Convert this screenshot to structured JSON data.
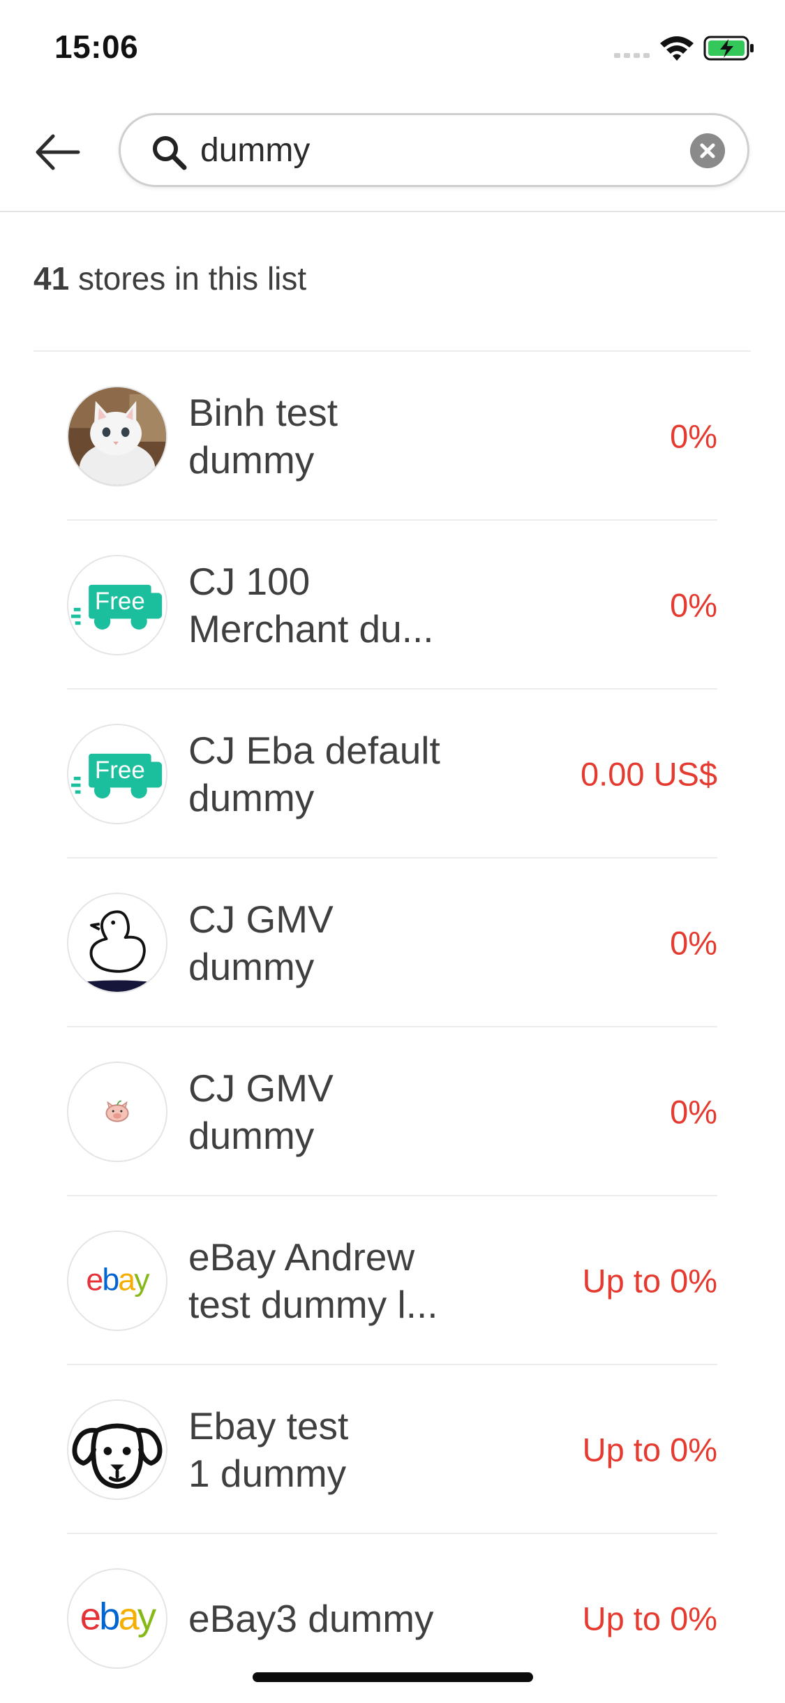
{
  "status_bar": {
    "time": "15:06"
  },
  "search": {
    "value": "dummy"
  },
  "count": {
    "number": "41",
    "label": "stores in this list"
  },
  "stores": [
    {
      "line1": "Binh test",
      "line2": "dummy",
      "rate": "0%",
      "logo": "cat-photo"
    },
    {
      "line1": "CJ 100",
      "line2": "Merchant du...",
      "rate": "0%",
      "logo": "free-shipping-truck",
      "logo_text": "Free"
    },
    {
      "line1": "CJ Eba default",
      "line2": "dummy",
      "rate": "0.00 US$",
      "logo": "free-shipping-truck",
      "logo_text": "Free"
    },
    {
      "line1": "CJ GMV",
      "line2": "dummy",
      "rate": "0%",
      "logo": "duck-outline"
    },
    {
      "line1": "CJ GMV",
      "line2": "dummy",
      "rate": "0%",
      "logo": "pig-face"
    },
    {
      "line1": "eBay Andrew",
      "line2": "test dummy l...",
      "rate": "Up to 0%",
      "logo": "ebay-wordmark",
      "logo_text": "ebay"
    },
    {
      "line1": "Ebay test",
      "line2": "1 dummy",
      "rate": "Up to 0%",
      "logo": "dog-face"
    },
    {
      "line1": "eBay3 dummy",
      "line2": "",
      "rate": "Up to 0%",
      "logo": "ebay-wordmark",
      "logo_text": "ebay"
    }
  ],
  "colors": {
    "rate": "#e53a2f",
    "free_truck": "#1bbf9d",
    "battery": "#34c759"
  }
}
